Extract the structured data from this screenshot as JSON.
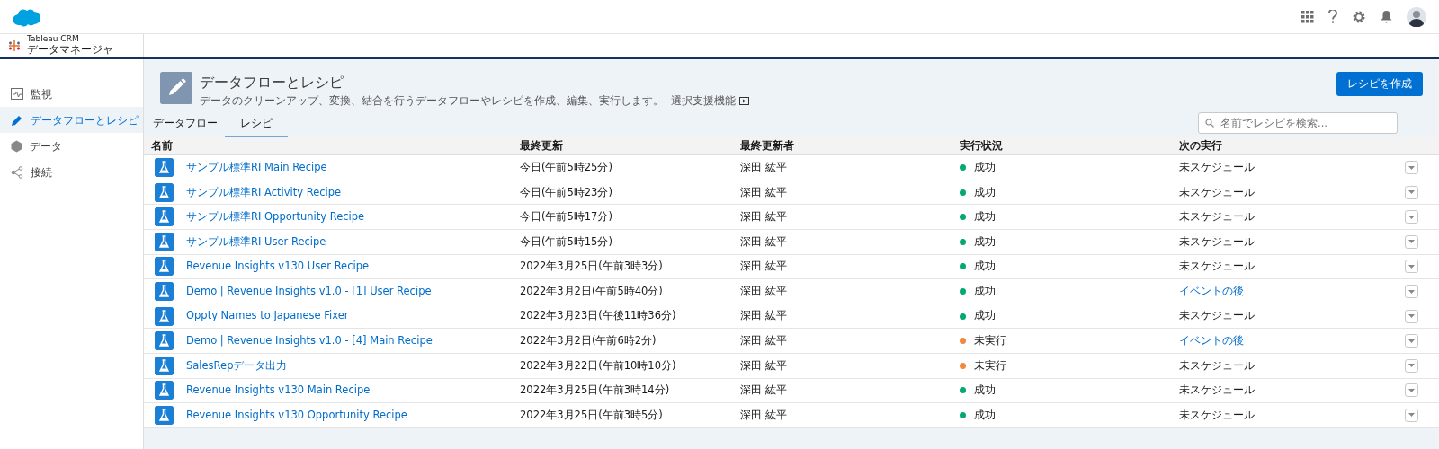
{
  "app": {
    "subtitle": "Tableau CRM",
    "title": "データマネージャ"
  },
  "sidebar": {
    "items": [
      {
        "label": "監視",
        "selected": false
      },
      {
        "label": "データフローとレシピ",
        "selected": true
      },
      {
        "label": "データ",
        "selected": false
      },
      {
        "label": "接続",
        "selected": false
      }
    ]
  },
  "page_header": {
    "title": "データフローとレシピ",
    "description": "データのクリーンアップ、変換、結合を行うデータフローやレシピを作成、編集、実行します。",
    "help_link": "選択支援機能",
    "button": "レシピを作成"
  },
  "tabs": [
    {
      "label": "データフロー",
      "selected": false
    },
    {
      "label": "レシピ",
      "selected": true
    }
  ],
  "search": {
    "placeholder": "名前でレシピを検索..."
  },
  "table": {
    "columns": [
      "名前",
      "最終更新",
      "最終更新者",
      "実行状況",
      "次の実行"
    ],
    "rows": [
      {
        "name": "サンプル標準RI Main Recipe",
        "updated": "今日(午前5時25分)",
        "updated_by": "深田 紘平",
        "status": {
          "label": "成功",
          "color": "#04a96e"
        },
        "next": {
          "text": "未スケジュール",
          "kind": "text"
        }
      },
      {
        "name": "サンプル標準RI Activity Recipe",
        "updated": "今日(午前5時23分)",
        "updated_by": "深田 紘平",
        "status": {
          "label": "成功",
          "color": "#04a96e"
        },
        "next": {
          "text": "未スケジュール",
          "kind": "text"
        }
      },
      {
        "name": "サンプル標準RI Opportunity Recipe",
        "updated": "今日(午前5時17分)",
        "updated_by": "深田 紘平",
        "status": {
          "label": "成功",
          "color": "#04a96e"
        },
        "next": {
          "text": "未スケジュール",
          "kind": "text"
        }
      },
      {
        "name": "サンプル標準RI User Recipe",
        "updated": "今日(午前5時15分)",
        "updated_by": "深田 紘平",
        "status": {
          "label": "成功",
          "color": "#04a96e"
        },
        "next": {
          "text": "未スケジュール",
          "kind": "text"
        }
      },
      {
        "name": "Revenue Insights v130 User Recipe",
        "updated": "2022年3月25日(午前3時3分)",
        "updated_by": "深田 紘平",
        "status": {
          "label": "成功",
          "color": "#04a96e"
        },
        "next": {
          "text": "未スケジュール",
          "kind": "text"
        }
      },
      {
        "name": "Demo | Revenue Insights v1.0 - [1] User Recipe",
        "updated": "2022年3月2日(午前5時40分)",
        "updated_by": "深田 紘平",
        "status": {
          "label": "成功",
          "color": "#04a96e"
        },
        "next": {
          "text": "イベントの後",
          "kind": "link"
        }
      },
      {
        "name": "Oppty Names to Japanese Fixer",
        "updated": "2022年3月23日(午後11時36分)",
        "updated_by": "深田 紘平",
        "status": {
          "label": "成功",
          "color": "#04a96e"
        },
        "next": {
          "text": "未スケジュール",
          "kind": "text"
        }
      },
      {
        "name": "Demo | Revenue Insights v1.0 - [4] Main Recipe",
        "updated": "2022年3月2日(午前6時2分)",
        "updated_by": "深田 紘平",
        "status": {
          "label": "未実行",
          "color": "#f08a3c"
        },
        "next": {
          "text": "イベントの後",
          "kind": "link"
        }
      },
      {
        "name": "SalesRepデータ出力",
        "updated": "2022年3月22日(午前10時10分)",
        "updated_by": "深田 紘平",
        "status": {
          "label": "未実行",
          "color": "#f08a3c"
        },
        "next": {
          "text": "未スケジュール",
          "kind": "text"
        }
      },
      {
        "name": "Revenue Insights v130 Main Recipe",
        "updated": "2022年3月25日(午前3時14分)",
        "updated_by": "深田 紘平",
        "status": {
          "label": "成功",
          "color": "#04a96e"
        },
        "next": {
          "text": "未スケジュール",
          "kind": "text"
        }
      },
      {
        "name": "Revenue Insights v130 Opportunity Recipe",
        "updated": "2022年3月25日(午前3時5分)",
        "updated_by": "深田 紘平",
        "status": {
          "label": "成功",
          "color": "#04a96e"
        },
        "next": {
          "text": "未スケジュール",
          "kind": "text"
        }
      }
    ]
  }
}
